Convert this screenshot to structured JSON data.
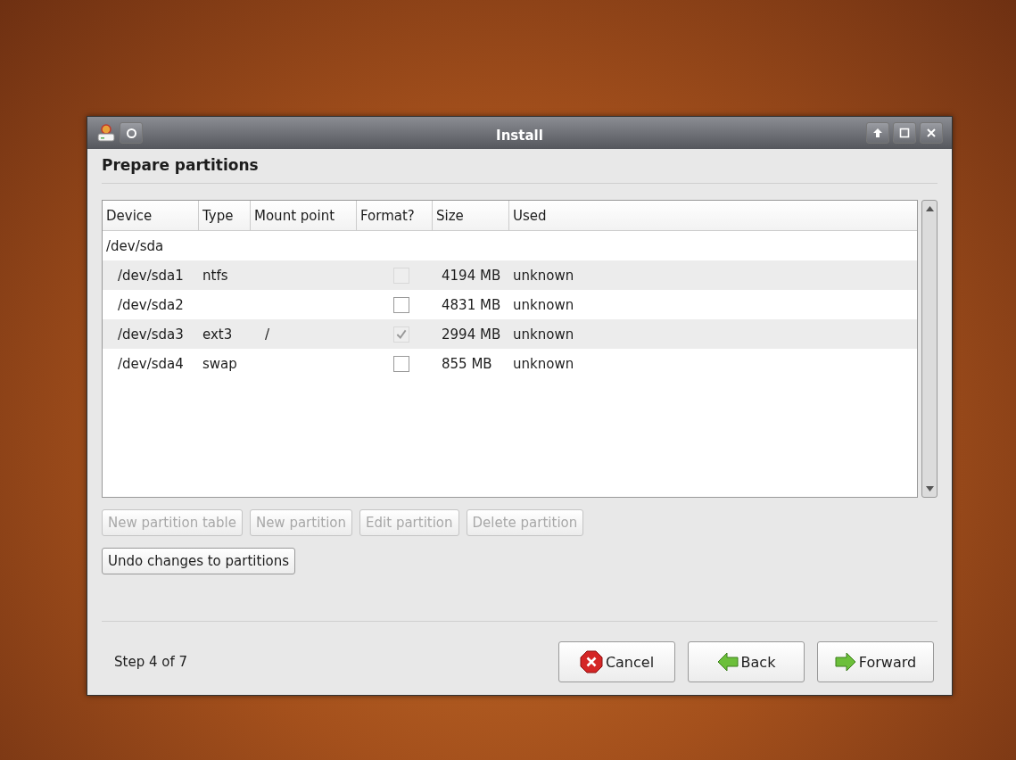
{
  "window": {
    "title": "Install"
  },
  "page_title": "Prepare partitions",
  "table": {
    "columns": [
      "Device",
      "Type",
      "Mount point",
      "Format?",
      "Size",
      "Used"
    ],
    "rows": [
      {
        "device": "/dev/sda",
        "children": [
          {
            "device": "/dev/sda1",
            "type": "ntfs",
            "format": {
              "checked": false,
              "disabled": true
            },
            "size": "4194 MB",
            "used": "unknown"
          },
          {
            "device": "/dev/sda2",
            "format": {
              "checked": false,
              "disabled": false
            },
            "size": "4831 MB",
            "used": "unknown"
          },
          {
            "device": "/dev/sda3",
            "type": "ext3",
            "mount_point": "/",
            "format": {
              "checked": true,
              "disabled": true
            },
            "size": "2994 MB",
            "used": "unknown"
          },
          {
            "device": "/dev/sda4",
            "type": "swap",
            "format": {
              "checked": false,
              "disabled": false
            },
            "size": "855 MB",
            "used": "unknown"
          }
        ]
      }
    ]
  },
  "partition_buttons": [
    {
      "label": "New partition table",
      "disabled": true
    },
    {
      "label": "New partition",
      "disabled": true
    },
    {
      "label": "Edit partition",
      "disabled": true
    },
    {
      "label": "Delete partition",
      "disabled": true
    }
  ],
  "undo_button": {
    "label": "Undo changes to partitions",
    "disabled": false
  },
  "step": "Step 4 of 7",
  "nav_buttons": [
    {
      "kind": "cancel",
      "label": "Cancel"
    },
    {
      "kind": "back",
      "label": "Back"
    },
    {
      "kind": "forward",
      "label": "Forward"
    }
  ]
}
